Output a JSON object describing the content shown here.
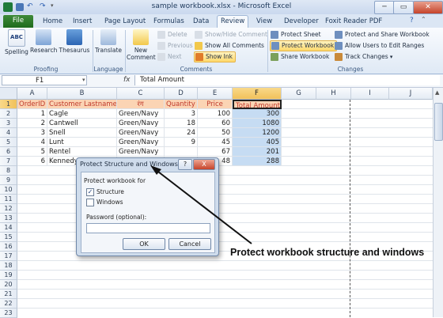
{
  "window": {
    "title": "sample workbook.xlsx - Microsoft Excel"
  },
  "tabs": [
    "File",
    "Home",
    "Insert",
    "Page Layout",
    "Formulas",
    "Data",
    "Review",
    "View",
    "Developer",
    "Foxit Reader PDF"
  ],
  "ribbon": {
    "proofing": {
      "label": "Proofing",
      "spelling": "Spelling",
      "research": "Research",
      "thesaurus": "Thesaurus"
    },
    "language": {
      "label": "Language",
      "translate": "Translate"
    },
    "comments": {
      "label": "Comments",
      "new_comment": "New Comment",
      "delete": "Delete",
      "previous": "Previous",
      "next": "Next",
      "show_hide_comment": "Show/Hide Comment",
      "show_all_comments": "Show All Comments",
      "show_ink": "Show Ink"
    },
    "changes": {
      "label": "Changes",
      "protect_sheet": "Protect Sheet",
      "protect_workbook": "Protect Workbook",
      "share_workbook": "Share Workbook",
      "protect_and_share": "Protect and Share Workbook",
      "allow_users": "Allow Users to Edit Ranges",
      "track_changes": "Track Changes"
    }
  },
  "formula_bar": {
    "name_box": "F1",
    "fx": "fx",
    "formula": "Total Amount"
  },
  "columns": [
    "A",
    "B",
    "C",
    "D",
    "E",
    "F",
    "G",
    "H",
    "I",
    "J"
  ],
  "rows": [
    "1",
    "2",
    "3",
    "4",
    "5",
    "6",
    "7",
    "8",
    "9",
    "10",
    "11",
    "12",
    "13",
    "14",
    "15",
    "16",
    "17",
    "18",
    "19",
    "20",
    "21",
    "22",
    "23"
  ],
  "table": {
    "headers": [
      "OrderID",
      "Customer Lastname",
      "रंग",
      "Quantity",
      "Price",
      "Total Amount"
    ],
    "data": [
      [
        "1",
        "Cagle",
        "Green/Navy",
        "3",
        "100",
        "300"
      ],
      [
        "2",
        "Cantwell",
        "Green/Navy",
        "18",
        "60",
        "1080"
      ],
      [
        "3",
        "Snell",
        "Green/Navy",
        "24",
        "50",
        "1200"
      ],
      [
        "4",
        "Lunt",
        "Green/Navy",
        "9",
        "45",
        "405"
      ],
      [
        "5",
        "Rentel",
        "Green/Navy",
        "",
        "67",
        "201"
      ],
      [
        "6",
        "Kennedy",
        "",
        "",
        "48",
        "288"
      ]
    ]
  },
  "dialog": {
    "title": "Protect Structure and Windows",
    "help": "?",
    "close": "X",
    "section_label": "Protect workbook for",
    "structure_label": "Structure",
    "structure_checked": "✓",
    "windows_label": "Windows",
    "password_label": "Password (optional):",
    "ok": "OK",
    "cancel": "Cancel"
  },
  "annotation": "Protect workbook structure and windows",
  "colors": {
    "header_fill": "#fbd4b4",
    "header_text": "#c0392b",
    "selection": "#c6dcf3",
    "file_tab": "#2e7d32"
  }
}
